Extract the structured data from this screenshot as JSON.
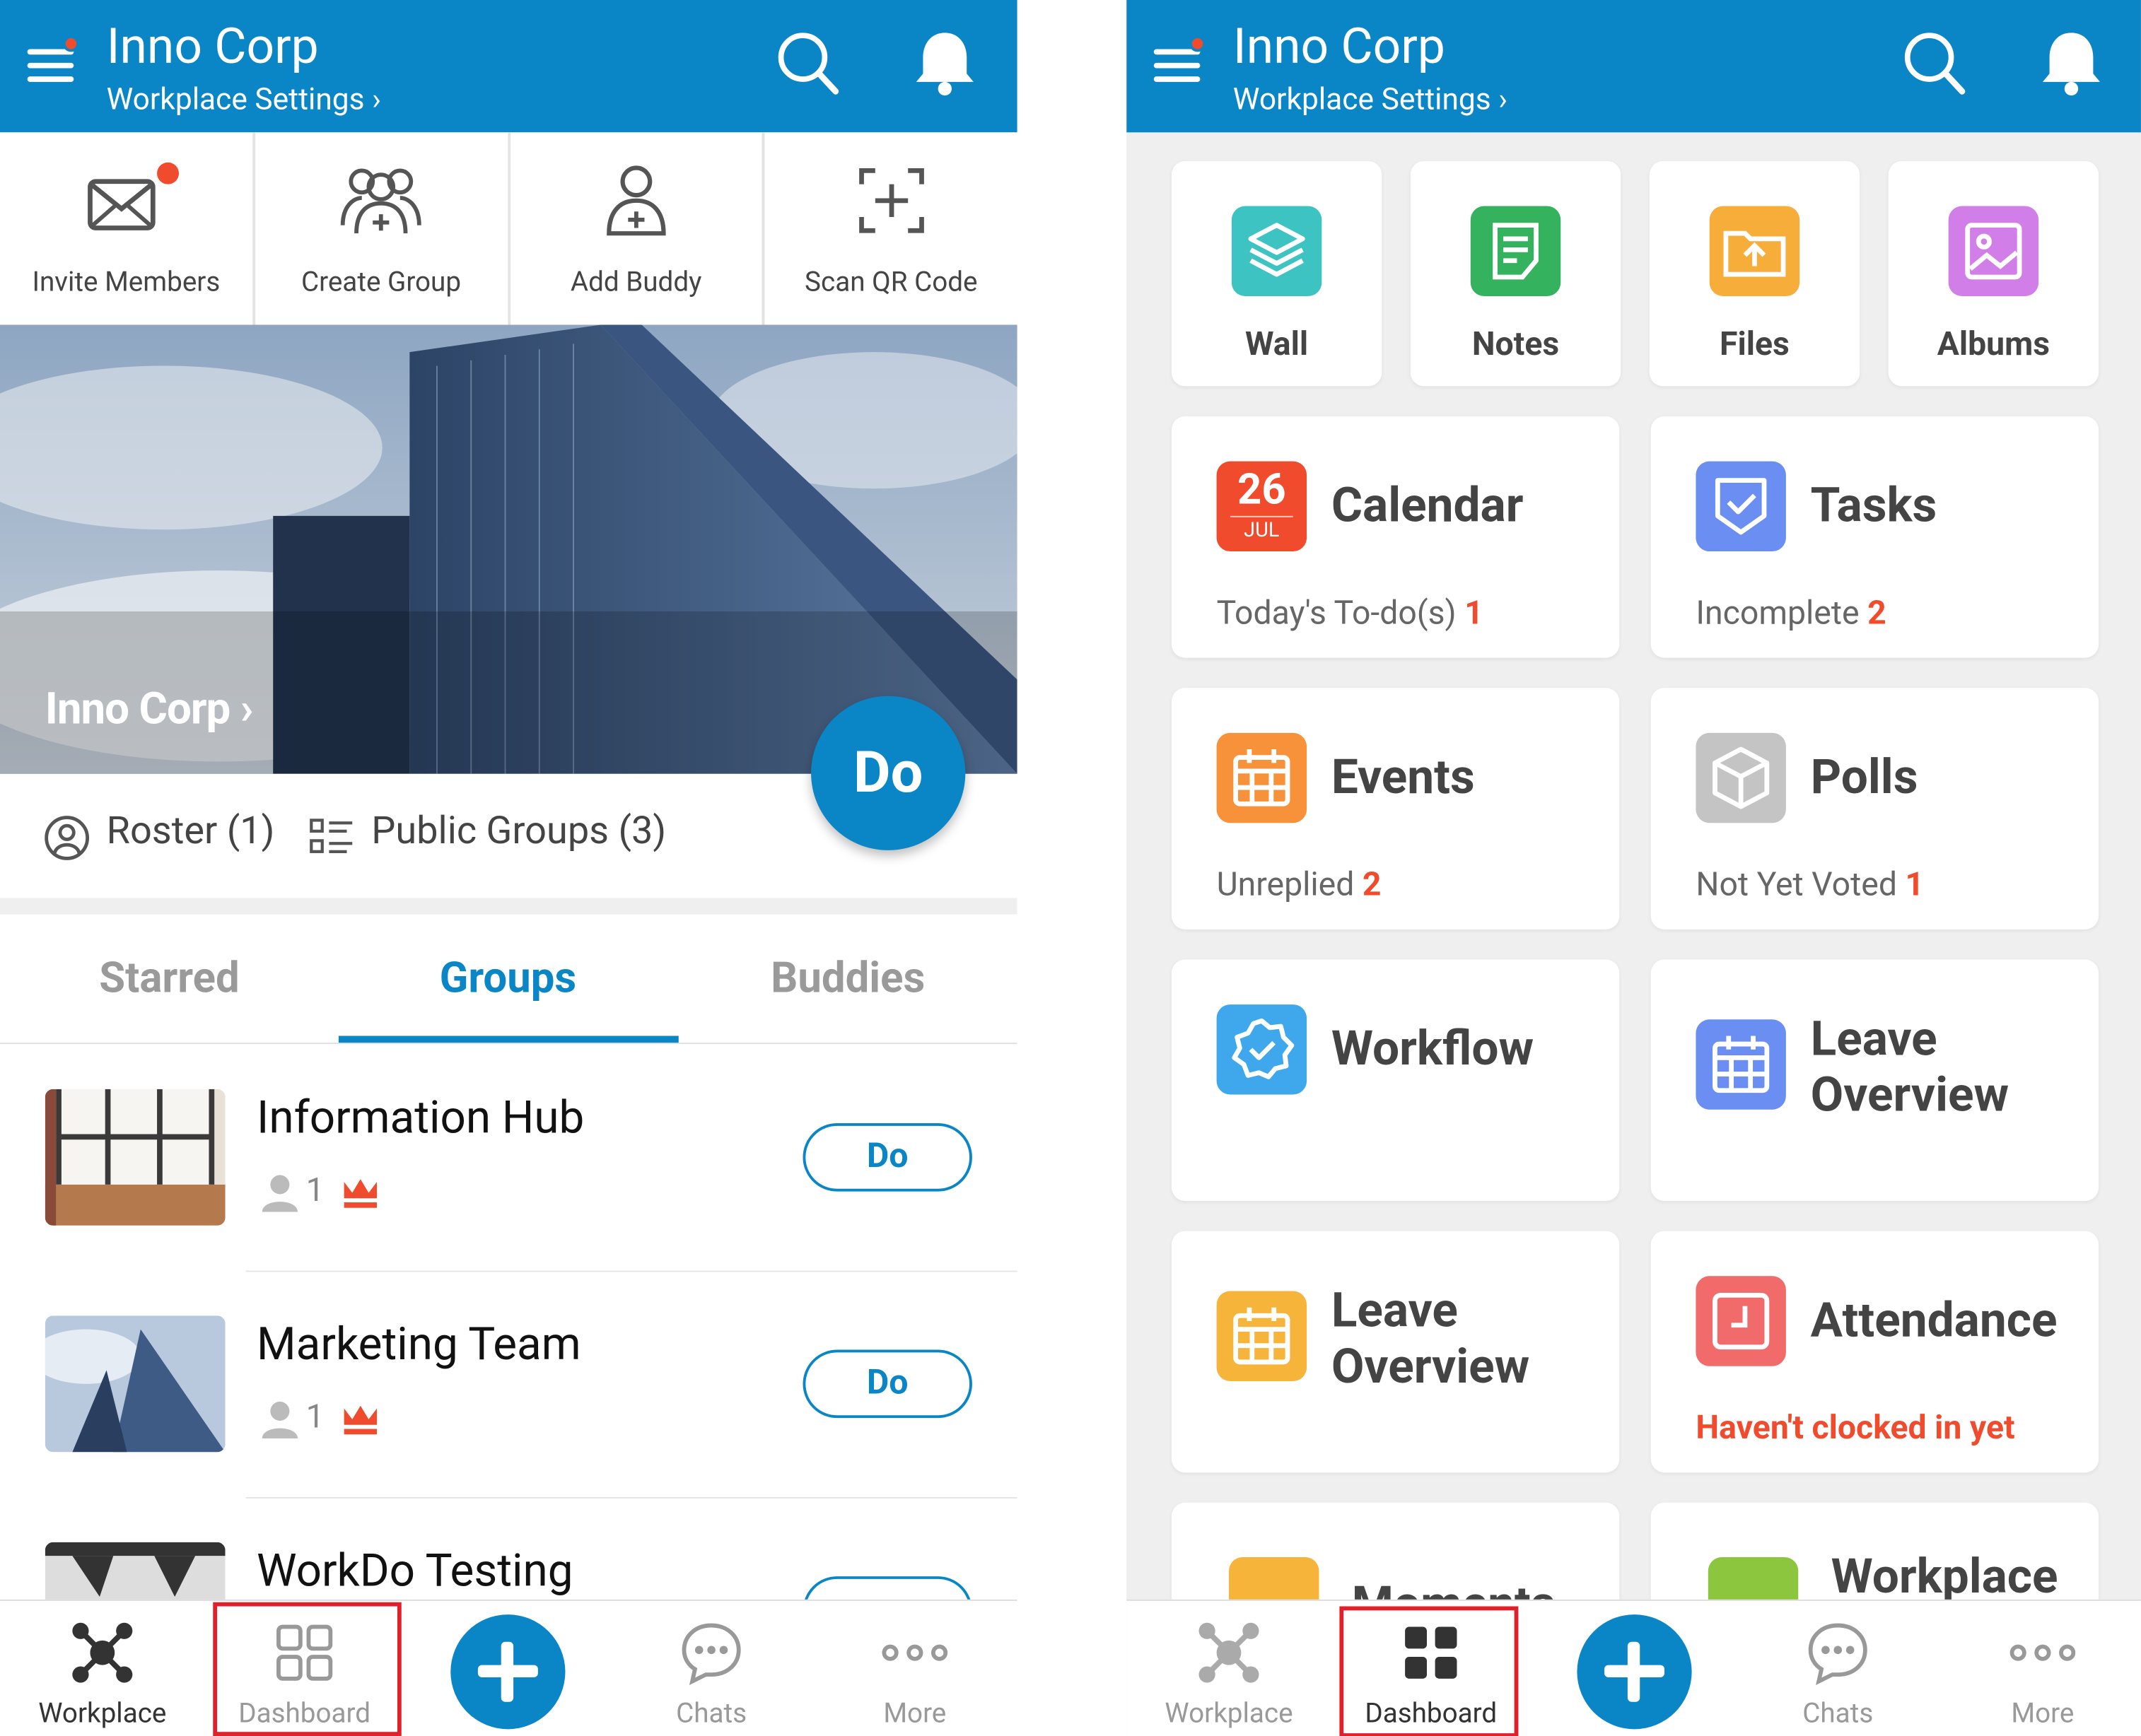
{
  "left_screen": {
    "header": {
      "title": "Inno Corp",
      "subtitle": "Workplace Settings"
    },
    "quick_actions": [
      {
        "label": "Invite Members",
        "icon": "invite-envelope-icon"
      },
      {
        "label": "Create Group",
        "icon": "create-group-icon"
      },
      {
        "label": "Add Buddy",
        "icon": "add-buddy-icon"
      },
      {
        "label": "Scan QR Code",
        "icon": "scan-qr-icon"
      }
    ],
    "hero": {
      "name": "Inno Corp",
      "fab_label": "Do"
    },
    "stats": {
      "roster": "Roster (1)",
      "public_groups": "Public Groups (3)"
    },
    "tabs": {
      "starred": "Starred",
      "groups": "Groups",
      "buddies": "Buddies"
    },
    "groups": [
      {
        "name": "Information Hub",
        "members": "1",
        "button": "Do"
      },
      {
        "name": "Marketing Team",
        "members": "1",
        "button": "Do"
      },
      {
        "name": "WorkDo Testing",
        "members": "",
        "button": ""
      }
    ],
    "nav": {
      "workplace": "Workplace",
      "dashboard": "Dashboard",
      "chats": "Chats",
      "more": "More"
    }
  },
  "right_screen": {
    "header": {
      "title": "Inno Corp",
      "subtitle": "Workplace Settings"
    },
    "apps": [
      {
        "label": "Wall",
        "color": "#3ec3c3",
        "icon": "wall-layers-icon"
      },
      {
        "label": "Notes",
        "color": "#35b25d",
        "icon": "notes-icon"
      },
      {
        "label": "Files",
        "color": "#f6ad3a",
        "icon": "files-folder-icon"
      },
      {
        "label": "Albums",
        "color": "#d27ee8",
        "icon": "albums-image-icon"
      }
    ],
    "calendar": {
      "title": "Calendar",
      "day": "26",
      "month": "JUL",
      "info_label": "Today's To-do(s)",
      "info_count": "1",
      "color": "#f04b2c"
    },
    "tasks": {
      "title": "Tasks",
      "info_label": "Incomplete",
      "info_count": "2",
      "color": "#6a8ef2"
    },
    "events": {
      "title": "Events",
      "info_label": "Unreplied",
      "info_count": "2",
      "color": "#f7923a"
    },
    "polls": {
      "title": "Polls",
      "info_label": "Not Yet Voted",
      "info_count": "1",
      "color": "#c4c4c4"
    },
    "workflow": {
      "title": "Workflow",
      "color": "#3fa7ec"
    },
    "leave_overview_blue": {
      "title_line1": "Leave",
      "title_line2": "Overview",
      "color": "#6a8ef2"
    },
    "leave_overview_orange": {
      "title_line1": "Leave",
      "title_line2": "Overview",
      "color": "#f7b43a"
    },
    "attendance": {
      "title": "Attendance",
      "status": "Haven't clocked in yet",
      "color": "#f26b6b"
    },
    "partial_cards": {
      "moments": "Moments",
      "workplace": "Workplace"
    },
    "nav": {
      "workplace": "Workplace",
      "dashboard": "Dashboard",
      "chats": "Chats",
      "more": "More"
    }
  }
}
